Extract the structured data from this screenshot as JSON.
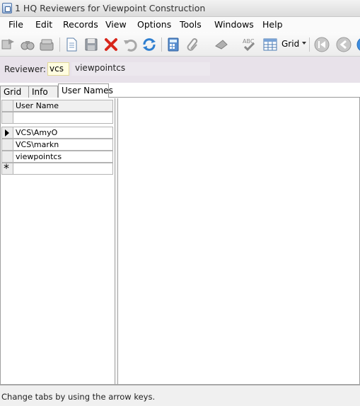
{
  "window": {
    "title": "1 HQ Reviewers for Viewpoint Construction"
  },
  "menu": [
    "File",
    "Edit",
    "Records",
    "View",
    "Options",
    "Tools",
    "Windows",
    "Help"
  ],
  "toolbar": {
    "icons": [
      "launch-icon",
      "find-icon",
      "folders-icon",
      "new-icon",
      "save-icon",
      "delete-icon",
      "undo-icon",
      "refresh-icon",
      "calculator-icon",
      "attachment-icon",
      "clear-icon",
      "spellcheck-icon",
      "grid-view-icon",
      "first-record-icon",
      "previous-record-icon",
      "next-record-icon"
    ],
    "grid_label": "Grid"
  },
  "reviewer": {
    "label": "Reviewer:",
    "code": "vcs",
    "name": "viewpointcs"
  },
  "tabs": [
    "Grid",
    "Info",
    "User Names"
  ],
  "active_tab": "User Names",
  "grid": {
    "column": "User Name",
    "rows": [
      "VCS\\AmyO",
      "VCS\\markn",
      "viewpointcs"
    ]
  },
  "status": "Change tabs by using the arrow keys."
}
